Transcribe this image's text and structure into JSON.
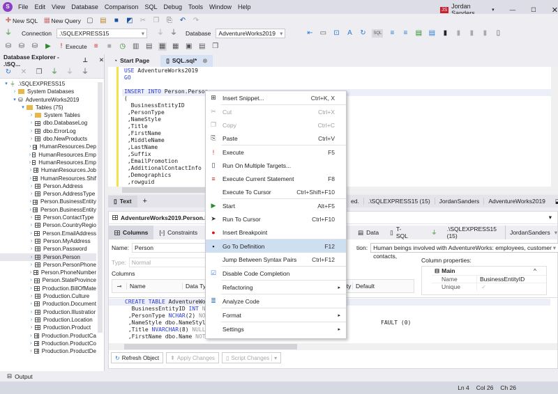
{
  "menubar": {
    "items": [
      "File",
      "Edit",
      "View",
      "Database",
      "Comparison",
      "SQL",
      "Debug",
      "Tools",
      "Window",
      "Help"
    ],
    "user_initials": "JS",
    "user_name": "Jordan Sanders"
  },
  "toolbar": {
    "new_sql": "New SQL",
    "new_query": "New Query",
    "connection_label": "Connection",
    "connection_value": ".\\SQLEXPRESS15",
    "database_label": "Database",
    "database_value": "AdventureWorks2019",
    "execute": "Execute"
  },
  "explorer": {
    "title": "Database Explorer - .\\SQ...",
    "tree": [
      {
        "label": ".\\SQLEXPRESS15",
        "level": 0,
        "type": "server",
        "expanded": true
      },
      {
        "label": "System Databases",
        "level": 1,
        "type": "folder"
      },
      {
        "label": "AdventureWorks2019",
        "level": 1,
        "type": "db",
        "expanded": true
      },
      {
        "label": "Tables (75)",
        "level": 2,
        "type": "folder",
        "expanded": true
      },
      {
        "label": "System Tables",
        "level": 3,
        "type": "folder"
      },
      {
        "label": "dbo.DatabaseLog",
        "level": 3,
        "type": "table"
      },
      {
        "label": "dbo.ErrorLog",
        "level": 3,
        "type": "table"
      },
      {
        "label": "dbo.NewProducts",
        "level": 3,
        "type": "table"
      },
      {
        "label": "HumanResources.Dep",
        "level": 3,
        "type": "table"
      },
      {
        "label": "HumanResources.Emp",
        "level": 3,
        "type": "table"
      },
      {
        "label": "HumanResources.Emp",
        "level": 3,
        "type": "table"
      },
      {
        "label": "HumanResources.Job",
        "level": 3,
        "type": "table"
      },
      {
        "label": "HumanResources.Shif",
        "level": 3,
        "type": "table"
      },
      {
        "label": "Person.Address",
        "level": 3,
        "type": "table"
      },
      {
        "label": "Person.AddressType",
        "level": 3,
        "type": "table"
      },
      {
        "label": "Person.BusinessEntity",
        "level": 3,
        "type": "table"
      },
      {
        "label": "Person.BusinessEntity",
        "level": 3,
        "type": "table"
      },
      {
        "label": "Person.ContactType",
        "level": 3,
        "type": "table"
      },
      {
        "label": "Person.CountryRegio",
        "level": 3,
        "type": "table"
      },
      {
        "label": "Person.EmailAddress",
        "level": 3,
        "type": "table"
      },
      {
        "label": "Person.MyAddress",
        "level": 3,
        "type": "table"
      },
      {
        "label": "Person.Password",
        "level": 3,
        "type": "table"
      },
      {
        "label": "Person.Person",
        "level": 3,
        "type": "table",
        "selected": true
      },
      {
        "label": "Person.PersonPhone",
        "level": 3,
        "type": "table"
      },
      {
        "label": "Person.PhoneNumber",
        "level": 3,
        "type": "table"
      },
      {
        "label": "Person.StateProvince",
        "level": 3,
        "type": "table"
      },
      {
        "label": "Production.BillOfMate",
        "level": 3,
        "type": "table"
      },
      {
        "label": "Production.Culture",
        "level": 3,
        "type": "table"
      },
      {
        "label": "Production.Document",
        "level": 3,
        "type": "table"
      },
      {
        "label": "Production.Illustratior",
        "level": 3,
        "type": "table"
      },
      {
        "label": "Production.Location",
        "level": 3,
        "type": "table"
      },
      {
        "label": "Production.Product",
        "level": 3,
        "type": "table"
      },
      {
        "label": "Production.ProductCa",
        "level": 3,
        "type": "table"
      },
      {
        "label": "Production.ProductCo",
        "level": 3,
        "type": "table"
      },
      {
        "label": "Production.ProductDe",
        "level": 3,
        "type": "table"
      }
    ]
  },
  "tabs": {
    "start_page": "Start Page",
    "sql": "SQL.sql*"
  },
  "editor": {
    "lines": [
      "USE AdventureWorks2019",
      "GO",
      "",
      "INSERT INTO Person.Person",
      "(",
      "  BusinessEntityID",
      " ,PersonType",
      " ,NameStyle",
      " ,Title",
      " ,FirstName",
      " ,MiddleName",
      " ,LastName",
      " ,Suffix",
      " ,EmailPromotion",
      " ,AdditionalContactInfo",
      " ,Demographics",
      " ,rowguid"
    ]
  },
  "result_bar": {
    "text_tab": "Text",
    "status": "ed.",
    "server": ".\\SQLEXPRESS15 (15)",
    "user": "JordanSanders",
    "database": "AdventureWorks2019"
  },
  "object_editor": {
    "title": "AdventureWorks2019.Person.Pe",
    "tabs": [
      "Columns",
      "Constraints",
      "Data",
      "T-SQL"
    ],
    "server": ".\\SQLEXPRESS15 (15)",
    "user": "JordanSanders",
    "name_label": "Name:",
    "name_value": "Person",
    "type_label": "Type:",
    "type_value": "Normal",
    "description_label": "tion:",
    "description_value": "Human beings involved with AdventureWorks: employees, customer contacts,",
    "columns_label": "Columns",
    "grid_headers": [
      "Name",
      "Data Type",
      "ll",
      "Identity",
      "Default"
    ],
    "column_properties_label": "Column properties:",
    "props_section": "Main",
    "props": [
      {
        "name": "Name",
        "value": "BusinessEntityID"
      },
      {
        "name": "Unique",
        "value": "✓"
      }
    ],
    "ddl_lines": [
      [
        {
          "t": "CREATE TABLE ",
          "c": "kw"
        },
        {
          "t": "AdventureWor",
          "c": ""
        }
      ],
      [
        {
          "t": "  BusinessEntityID ",
          "c": ""
        },
        {
          "t": "INT ",
          "c": "kw"
        },
        {
          "t": "NO",
          "c": "gr"
        }
      ],
      [
        {
          "t": " ,PersonType ",
          "c": ""
        },
        {
          "t": "NCHAR",
          "c": "kw"
        },
        {
          "t": "(2) ",
          "c": ""
        },
        {
          "t": "NOT",
          "c": "gr"
        }
      ],
      [
        {
          "t": " ,NameStyle dbo.NameStyle",
          "c": ""
        }
      ],
      [
        {
          "t": " ,Title ",
          "c": ""
        },
        {
          "t": "NVARCHAR",
          "c": "kw"
        },
        {
          "t": "(8) ",
          "c": ""
        },
        {
          "t": "NULL",
          "c": "gr"
        }
      ],
      [
        {
          "t": " ,FirstName dbo.Name ",
          "c": ""
        },
        {
          "t": "NOT",
          "c": "gr"
        }
      ]
    ],
    "ddl_tail": "FAULT (0)",
    "buttons": {
      "refresh": "Refresh Object",
      "apply": "Apply Changes",
      "script": "Script Changes"
    }
  },
  "context_menu": {
    "items": [
      {
        "label": "Insert Snippet...",
        "shortcut": "Ctrl+K, X",
        "icon": "snippet-icon",
        "sep": true
      },
      {
        "label": "Cut",
        "shortcut": "Ctrl+X",
        "icon": "cut-icon",
        "disabled": true
      },
      {
        "label": "Copy",
        "shortcut": "Ctrl+C",
        "icon": "copy-icon",
        "disabled": true
      },
      {
        "label": "Paste",
        "shortcut": "Ctrl+V",
        "icon": "paste-icon",
        "sep": true
      },
      {
        "label": "Execute",
        "shortcut": "F5",
        "icon": "execute-icon"
      },
      {
        "label": "Run On Multiple Targets...",
        "shortcut": "",
        "icon": "multi-target-icon"
      },
      {
        "label": "Execute Current Statement",
        "shortcut": "F8",
        "icon": "execute-statement-icon"
      },
      {
        "label": "Execute To Cursor",
        "shortcut": "Ctrl+Shift+F10",
        "icon": "",
        "sep": true
      },
      {
        "label": "Start",
        "shortcut": "Alt+F5",
        "icon": "play-icon"
      },
      {
        "label": "Run To Cursor",
        "shortcut": "Ctrl+F10",
        "icon": "cursor-icon"
      },
      {
        "label": "Insert Breakpoint",
        "shortcut": "",
        "icon": "breakpoint-icon",
        "sep": true
      },
      {
        "label": "Go To Definition",
        "shortcut": "F12",
        "icon": "go-to-definition-icon",
        "highlighted": true
      },
      {
        "label": "Jump Between Syntax Pairs",
        "shortcut": "Ctrl+F12",
        "icon": "",
        "sep": true
      },
      {
        "label": "Disable Code Completion",
        "shortcut": "",
        "icon": "sql-completion-icon",
        "sep": true
      },
      {
        "label": "Refactoring",
        "shortcut": "",
        "icon": "",
        "submenu": true,
        "sep": true
      },
      {
        "label": "Analyze Code",
        "shortcut": "",
        "icon": "analyze-icon",
        "sep": true
      },
      {
        "label": "Format",
        "shortcut": "",
        "icon": "",
        "submenu": true,
        "sep": true
      },
      {
        "label": "Settings",
        "shortcut": "",
        "icon": "",
        "submenu": true
      }
    ]
  },
  "output": {
    "label": "Output"
  },
  "statusbar": {
    "ln": "Ln 4",
    "col": "Col 26",
    "ch": "Ch 26"
  },
  "colors": {
    "accent": "#2a3cd6",
    "highlight": "#cfdff2",
    "logo": "#8a3fc7",
    "user_badge": "#c8202c"
  }
}
